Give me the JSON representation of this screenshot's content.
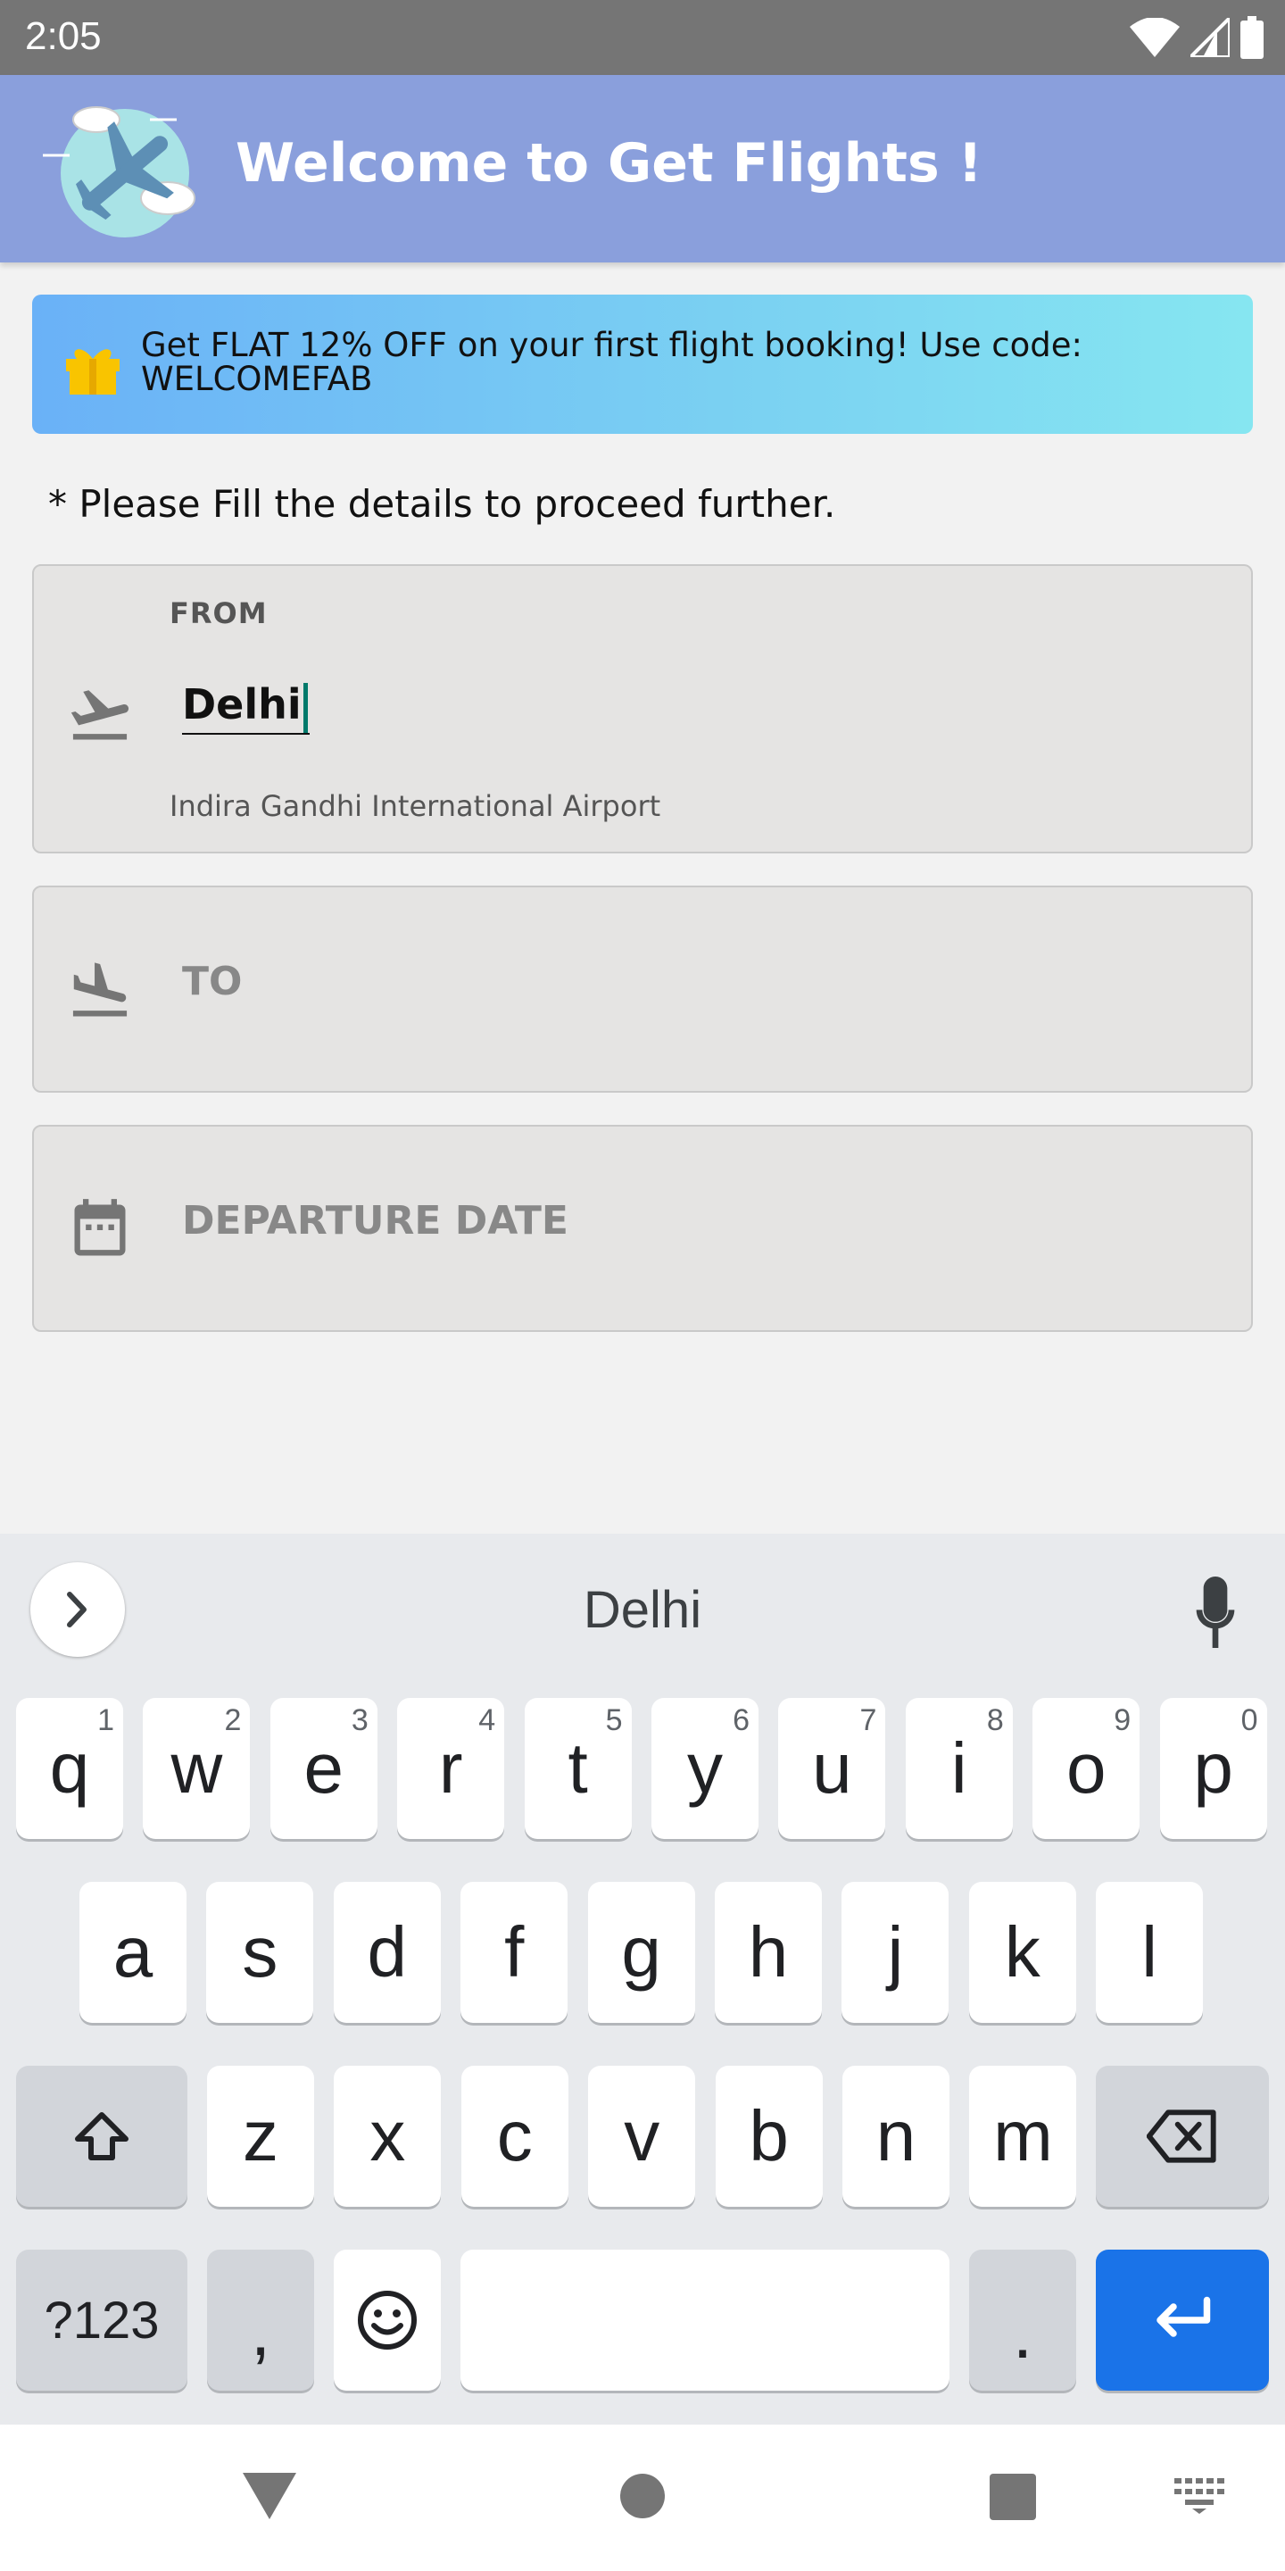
{
  "status_bar": {
    "time": "2:05"
  },
  "app_bar": {
    "title": "Welcome to Get Flights !"
  },
  "promo": {
    "text": "Get FLAT 12% OFF on your first flight booking! Use code: WELCOMEFAB"
  },
  "instruction": "* Please Fill the details to proceed further.",
  "form": {
    "from": {
      "label": "FROM",
      "value": "Delhi",
      "airport": "Indira Gandhi International Airport"
    },
    "to": {
      "placeholder": "TO"
    },
    "departure": {
      "placeholder": "DEPARTURE DATE"
    }
  },
  "keyboard": {
    "suggestion": "Delhi",
    "row1": [
      {
        "k": "q",
        "h": "1"
      },
      {
        "k": "w",
        "h": "2"
      },
      {
        "k": "e",
        "h": "3"
      },
      {
        "k": "r",
        "h": "4"
      },
      {
        "k": "t",
        "h": "5"
      },
      {
        "k": "y",
        "h": "6"
      },
      {
        "k": "u",
        "h": "7"
      },
      {
        "k": "i",
        "h": "8"
      },
      {
        "k": "o",
        "h": "9"
      },
      {
        "k": "p",
        "h": "0"
      }
    ],
    "row2": [
      "a",
      "s",
      "d",
      "f",
      "g",
      "h",
      "j",
      "k",
      "l"
    ],
    "row3": [
      "z",
      "x",
      "c",
      "v",
      "b",
      "n",
      "m"
    ],
    "symbols_label": "?123",
    "comma": ",",
    "period": "."
  },
  "colors": {
    "app_bar": "#8a9fdc",
    "caret": "#00796b",
    "enter_key": "#1a73e8",
    "gift": "#f9c400"
  },
  "icons": {
    "gift": "gift-icon",
    "from": "flight-takeoff-icon",
    "to": "flight-land-icon",
    "date": "calendar-icon",
    "mic": "mic-icon",
    "expand": "chevron-right-icon",
    "shift": "shift-icon",
    "backspace": "backspace-icon",
    "emoji": "emoji-icon",
    "enter": "enter-icon"
  }
}
